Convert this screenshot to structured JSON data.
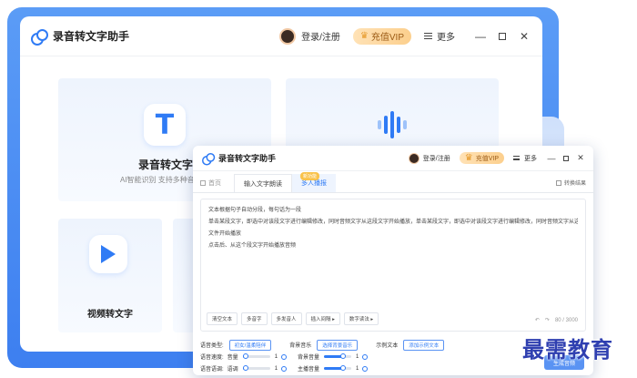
{
  "back_window": {
    "title": "录音转文字助手",
    "login": "登录/注册",
    "vip": "充值VIP",
    "more": "更多",
    "cards": [
      {
        "title": "录音转文字",
        "sub": "AI智能识别 支持多种音频"
      },
      {
        "title": "视频转文字"
      }
    ]
  },
  "front_window": {
    "title": "录音转文字助手",
    "login": "登录/注册",
    "vip": "充值VIP",
    "more": "更多",
    "tabs": {
      "home": "首页",
      "input": "输入文字朗读",
      "multi": "多人播报",
      "hot": "新功能",
      "result": "转换结果"
    },
    "editor_lines": [
      "文本根据句子自动分段，每句话为一段",
      "单击某段文字，即选中对该段文字进行编辑修改，同时音频文字从这段文字开始播放，单击某段文字，即选中对该段文字进行编辑修改，同时音频文字从这段",
      "文件开始播放",
      "点击后、从这个段文字开始播放音频"
    ],
    "tools": [
      "清空文本",
      "多音字",
      "多发音人",
      "插入间隔 ▸",
      "数字读法 ▸"
    ],
    "count": "80 / 3000",
    "settings": {
      "voice_type_label": "语音类型:",
      "voice_type_value": "初女/温柔陪伴",
      "bgm_label": "背景音乐",
      "bgm_value": "选择背景音乐",
      "sample_label": "示例文本",
      "sample_value": "添加示例文本",
      "speed_label": "语音速度:",
      "volume_label": "音量",
      "bgvol_label": "背景音量",
      "tone_label": "语音语调:",
      "pitch_label": "语调",
      "main_vol_label": "主播音量",
      "val_1": "1",
      "speed_level": 0.5,
      "volume_level": 0.1,
      "bgvol_level": 0.7,
      "pitch_level": 0.1,
      "mainvol_level": 0.7
    },
    "generate": "生成音频"
  },
  "watermark": "最需教育",
  "colors": {
    "accent": "#2f7bf5",
    "vip_text": "#9b5a14",
    "frame": "#4a8df4"
  }
}
